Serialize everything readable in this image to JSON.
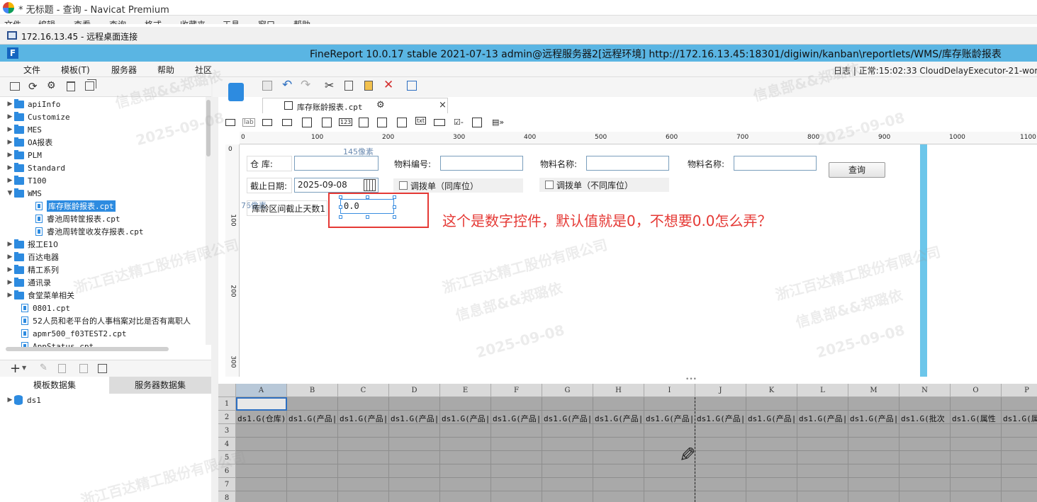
{
  "navicat": {
    "title": "* 无标题 - 查询 - Navicat Premium",
    "menu": [
      "文件",
      "编辑",
      "查看",
      "查询",
      "格式",
      "收藏夹",
      "工具",
      "窗口",
      "帮助"
    ]
  },
  "rdp": {
    "title": "172.16.13.45 - 远程桌面连接"
  },
  "finereport": {
    "title": "FineReport 10.0.17 stable 2021-07-13 admin@远程服务器2[远程环境]    http://172.16.13.45:18301/digiwin/kanban\\reportlets/WMS/库存账龄报表",
    "menu": [
      "文件",
      "模板(T)",
      "服务器",
      "帮助",
      "社区"
    ],
    "status": "日志 | 正常:15:02:33 CloudDelayExecutor-21-worker"
  },
  "tree": [
    {
      "label": "apiInfo",
      "type": "folder",
      "level": 0,
      "arrow": "▶"
    },
    {
      "label": "Customize",
      "type": "folder",
      "level": 0,
      "arrow": "▶"
    },
    {
      "label": "MES",
      "type": "folder",
      "level": 0,
      "arrow": "▶"
    },
    {
      "label": "OA报表",
      "type": "folder",
      "level": 0,
      "arrow": "▶"
    },
    {
      "label": "PLM",
      "type": "folder",
      "level": 0,
      "arrow": "▶"
    },
    {
      "label": "Standard",
      "type": "folder",
      "level": 0,
      "arrow": "▶"
    },
    {
      "label": "T100",
      "type": "folder",
      "level": 0,
      "arrow": "▶"
    },
    {
      "label": "WMS",
      "type": "folder",
      "level": 0,
      "arrow": "▼"
    },
    {
      "label": "库存账龄报表.cpt",
      "type": "file",
      "level": 1,
      "selected": true
    },
    {
      "label": "睿池周转筐报表.cpt",
      "type": "file",
      "level": 1
    },
    {
      "label": "睿池周转筐收发存报表.cpt",
      "type": "file",
      "level": 1
    },
    {
      "label": "报工E10",
      "type": "folder",
      "level": 0,
      "arrow": "▶"
    },
    {
      "label": "百达电器",
      "type": "folder",
      "level": 0,
      "arrow": "▶"
    },
    {
      "label": "精工系列",
      "type": "folder",
      "level": 0,
      "arrow": "▶"
    },
    {
      "label": "通讯录",
      "type": "folder",
      "level": 0,
      "arrow": "▶"
    },
    {
      "label": "食堂菜单相关",
      "type": "folder",
      "level": 0,
      "arrow": "▶"
    },
    {
      "label": "0801.cpt",
      "type": "file",
      "level": 0
    },
    {
      "label": "52人员和老平台的人事档案对比是否有离职人",
      "type": "file",
      "level": 0
    },
    {
      "label": "apmr500_f03TEST2.cpt",
      "type": "file",
      "level": 0
    },
    {
      "label": "AppStatus.cpt",
      "type": "file",
      "level": 0
    }
  ],
  "datasets": {
    "tabs": [
      "模板数据集",
      "服务器数据集"
    ],
    "items": [
      "ds1"
    ]
  },
  "editor": {
    "doc_tab": "库存账龄报表.cpt",
    "ruler_h": [
      "0",
      "100",
      "200",
      "300",
      "400",
      "500",
      "600",
      "700",
      "800",
      "900",
      "1000",
      "1100"
    ],
    "ruler_v": [
      "0",
      "100",
      "200",
      "300"
    ],
    "px_hint_top": "145像素",
    "px_hint_left": "76像素"
  },
  "form": {
    "warehouse_label": "仓    库:",
    "item_code_label": "物料编号:",
    "item_name_label": "物料名称:",
    "item_name2_label": "物料名称:",
    "query_button": "查询",
    "date_label": "截止日期:",
    "date_value": "2025-09-08",
    "chk_same": "调拨单（同库位）",
    "chk_diff": "调拨单（不同库位）",
    "days_label": "库龄区间截止天数1",
    "number_value": "0.0"
  },
  "annotation": "这个是数字控件，默认值就是0，不想要0.0怎么弄？",
  "grid": {
    "columns": [
      "A",
      "B",
      "C",
      "D",
      "E",
      "F",
      "G",
      "H",
      "I",
      "J",
      "K",
      "L",
      "M",
      "N",
      "O",
      "P"
    ],
    "rows": [
      "1",
      "2",
      "3",
      "4",
      "5",
      "6",
      "7",
      "8"
    ],
    "row2": [
      "ds1.G(仓库)",
      "ds1.G(产品|",
      "ds1.G(产品|",
      "ds1.G(产品|",
      "ds1.G(产品|",
      "ds1.G(产品|",
      "ds1.G(产品|",
      "ds1.G(产品|",
      "ds1.G(产品|",
      "ds1.G(产品|",
      "ds1.G(产品|",
      "ds1.G(产品|",
      "ds1.G(产品|",
      "ds1.G(批次",
      "ds1.G(属性",
      "ds1.G(属"
    ]
  },
  "watermark": {
    "company": "浙江百达精工股份有限公司",
    "dept": "信息部&&郑璐依",
    "date": "2025-09-08"
  }
}
